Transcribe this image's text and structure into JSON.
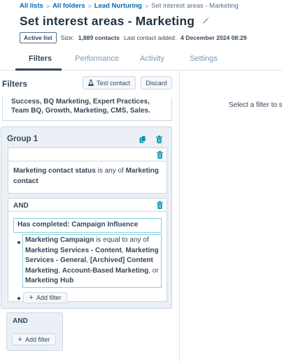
{
  "breadcrumb": {
    "all_lists": "All lists",
    "all_folders": "All folders",
    "lead_nurturing": "Lead Nurturing",
    "current": "Set interest areas - Marketing",
    "separator": ">"
  },
  "header": {
    "title": "Set interest areas - Marketing",
    "edit_icon": "pencil-icon",
    "status_badge": "Active list",
    "size_label": "Size:",
    "size_value": "1,889 contacts",
    "last_added_label": "Last contact added:",
    "last_added_value": "4 December 2024 08:29"
  },
  "tabs": [
    {
      "label": "Filters",
      "active": true
    },
    {
      "label": "Performance",
      "active": false
    },
    {
      "label": "Activity",
      "active": false
    },
    {
      "label": "Settings",
      "active": false
    }
  ],
  "filters_panel": {
    "title": "Filters",
    "test_contact_label": "Test contact",
    "discard_label": "Discard",
    "previous_values_line1": "Success, BQ Marketing, Expert Practices,",
    "previous_values_line2": "Team BQ, Growth, Marketing, CMS, Sales.",
    "group": {
      "title": "Group 1",
      "filter1": {
        "property": "Marketing contact status",
        "operator": "is any of",
        "value_part1": "Marketing",
        "value_part2": "contact"
      },
      "and_label": "AND",
      "condition_label": "Has completed: Campaign Influence",
      "campaign_filter": {
        "property": "Marketing Campaign",
        "operator": "is equal to any of",
        "value1": "Marketing Services - Content",
        "comma": ",",
        "value2_line1": "Marketing",
        "value2_line2": "Services - General",
        "value3_part1": "[Archived] Content",
        "value3_part2": "Marketing",
        "value4": "Account-Based Marketing",
        "or": ", or",
        "value5": "Marketing Hub"
      },
      "add_filter_label": "Add filter"
    },
    "and_group": {
      "label": "AND",
      "add_filter_label": "Add filter"
    }
  },
  "right_panel": {
    "placeholder": "Select a filter to s"
  },
  "colors": {
    "link": "#0069b4",
    "text": "#33475b",
    "border": "#cbd6e2",
    "group_bg": "#eaf0f6",
    "focus_border": "#7fd1de",
    "trash_icon": "#00a4bd"
  }
}
